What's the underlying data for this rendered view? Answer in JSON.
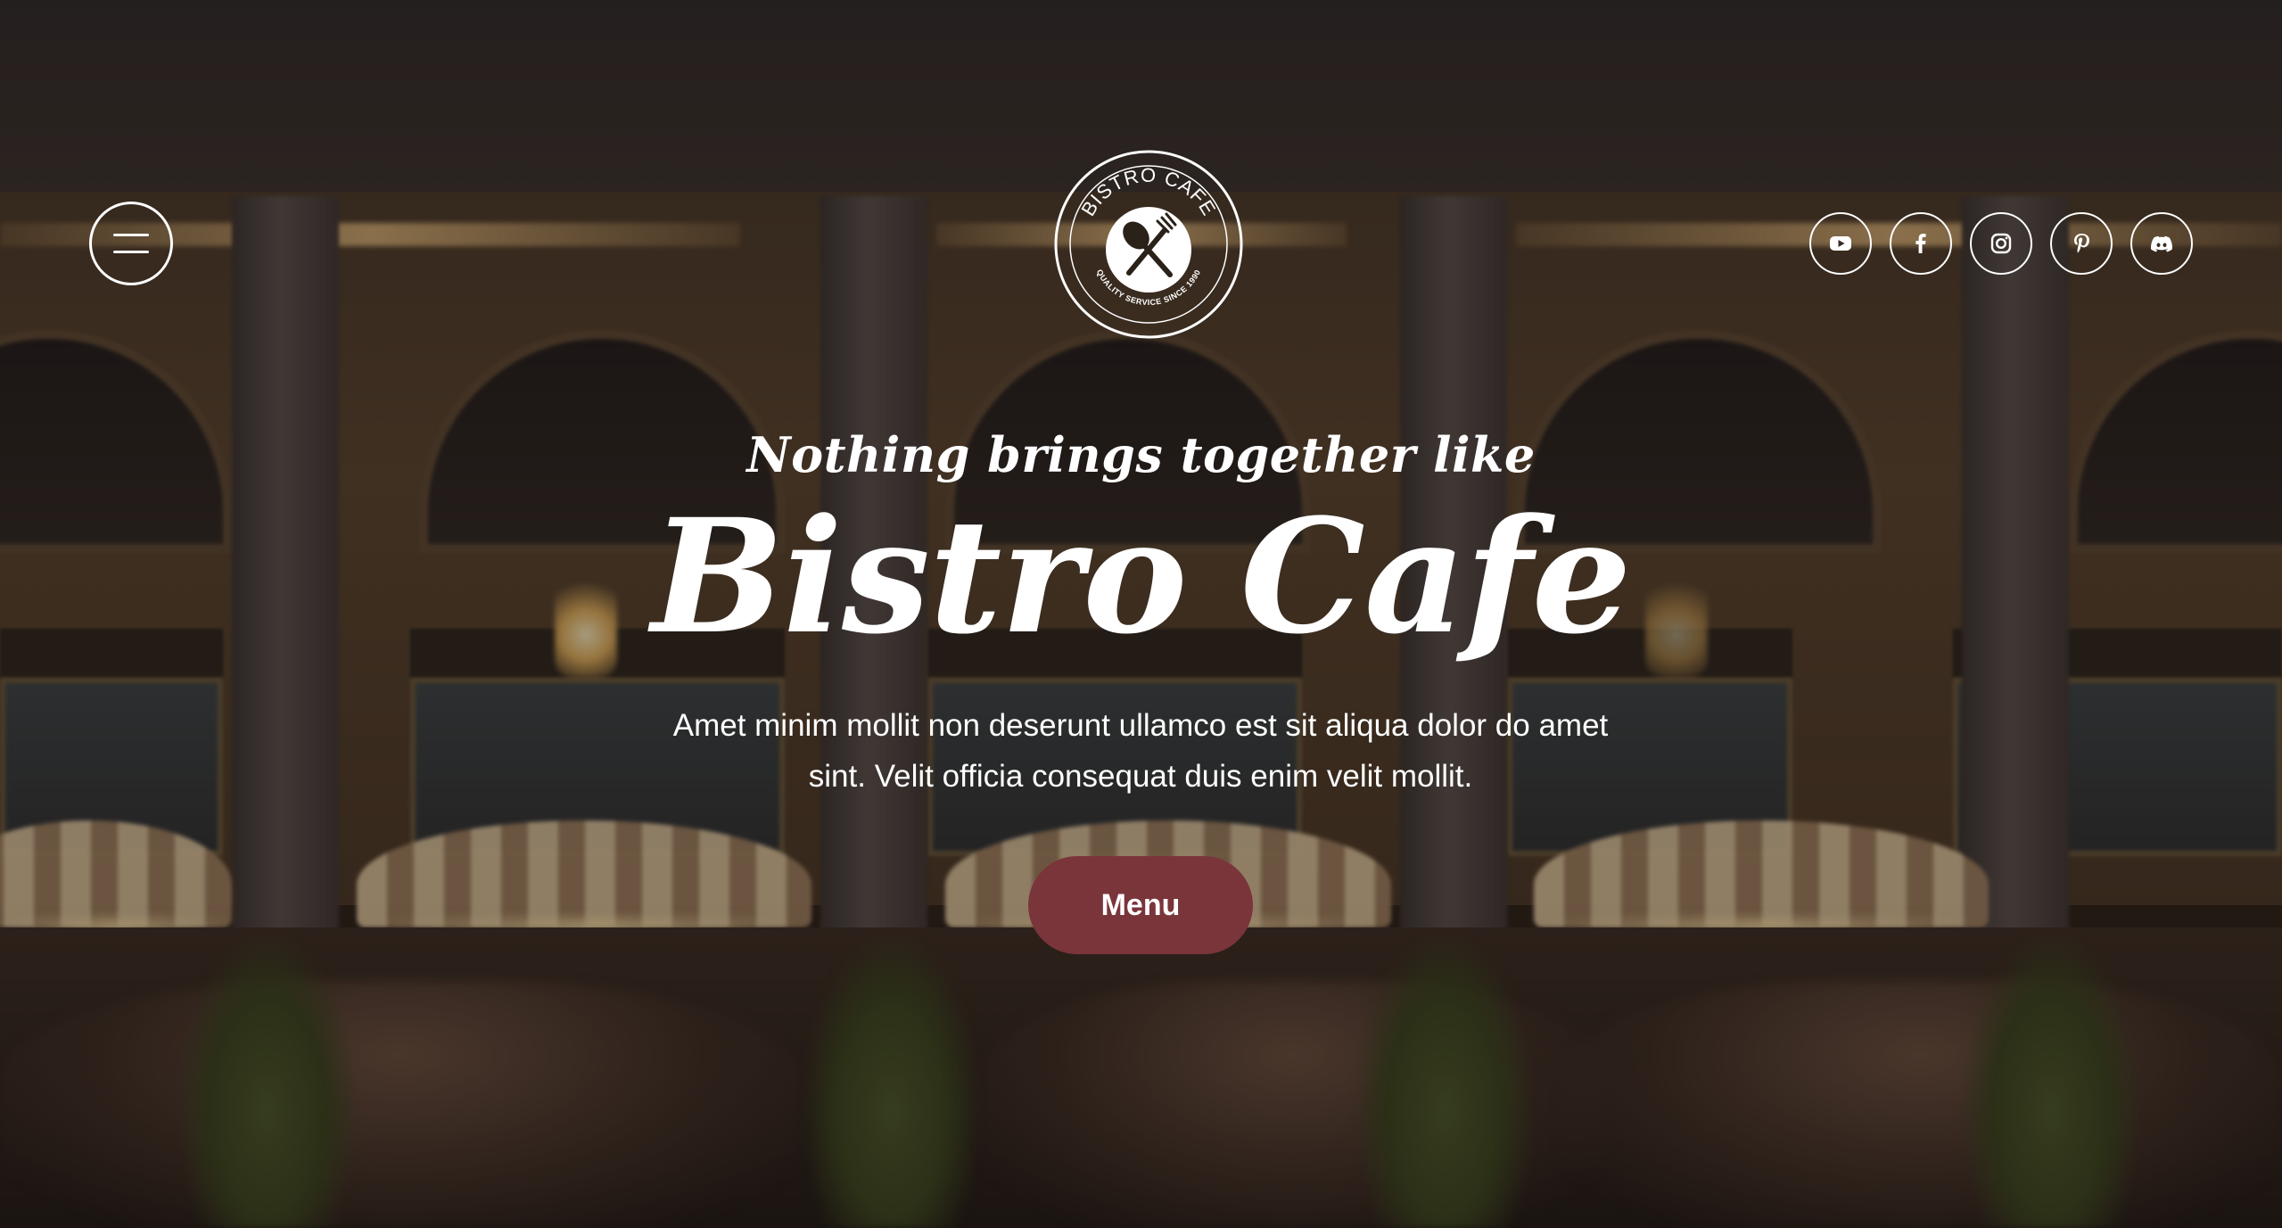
{
  "header": {
    "logo": {
      "arc_top": "BISTRO CAFE",
      "arc_bottom": "QUALITY SERVICE SINCE 1990"
    },
    "socials": [
      {
        "icon": "youtube-icon"
      },
      {
        "icon": "facebook-icon"
      },
      {
        "icon": "instagram-icon"
      },
      {
        "icon": "pinterest-icon"
      },
      {
        "icon": "discord-icon"
      }
    ]
  },
  "hero": {
    "tagline": "Nothing brings together like",
    "headline": "Bistro Cafe",
    "description": "Amet minim mollit non deserunt ullamco est sit aliqua dolor do amet sint. Velit officia consequat duis enim velit mollit.",
    "cta_label": "Menu"
  },
  "colors": {
    "cta_background": "#7a353a",
    "text": "#ffffff"
  }
}
